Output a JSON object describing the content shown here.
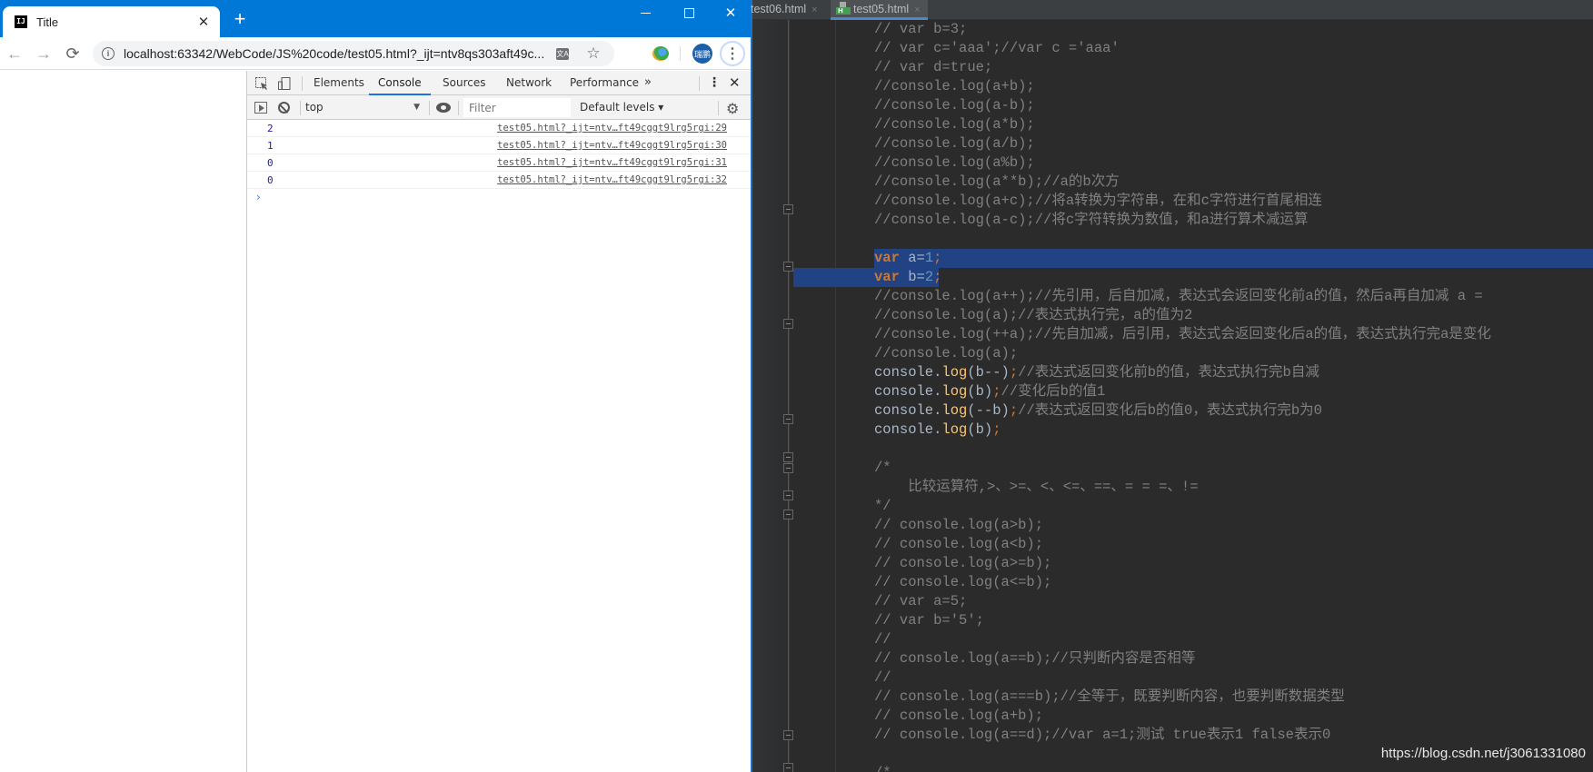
{
  "browser": {
    "tab": {
      "favicon": "IJ",
      "title": "Title",
      "close": "✕"
    },
    "new_tab": "+",
    "window_controls": {
      "minimize": "minimize",
      "maximize": "maximize",
      "close": "✕"
    },
    "nav": {
      "back": "←",
      "forward": "→",
      "reload": "⟳"
    },
    "url": "localhost:63342/WebCode/JS%20code/test05.html?_ijt=ntv8qs303aft49c...",
    "avatar_text": "瑞鹏",
    "menu": "⋮"
  },
  "devtools": {
    "tabs": [
      "Elements",
      "Console",
      "Sources",
      "Network",
      "Performance"
    ],
    "active_tab": "Console",
    "more": "»",
    "kebab": "⋮",
    "close": "✕",
    "context": "top",
    "filter_placeholder": "Filter",
    "levels": "Default levels ▾",
    "console": [
      {
        "value": "2",
        "source": "test05.html?_ijt=ntv…ft49cggt9lrg5rgi:29"
      },
      {
        "value": "1",
        "source": "test05.html?_ijt=ntv…ft49cggt9lrg5rgi:30"
      },
      {
        "value": "0",
        "source": "test05.html?_ijt=ntv…ft49cggt9lrg5rgi:31"
      },
      {
        "value": "0",
        "source": "test05.html?_ijt=ntv…ft49cggt9lrg5rgi:32"
      }
    ],
    "prompt": "›"
  },
  "ide": {
    "tabs": [
      {
        "label": "test06.html",
        "close": "×",
        "active": false
      },
      {
        "label": "test05.html",
        "close": "×",
        "active": true
      }
    ],
    "lines": [
      "// var b=3;",
      "// var c='aaa';//var c ='aaa'",
      "// var d=true;",
      "//console.log(a+b);",
      "//console.log(a-b);",
      "//console.log(a*b);",
      "//console.log(a/b);",
      "//console.log(a%b);",
      "//console.log(a**b);//a的b次方",
      "//console.log(a+c);//将a转换为字符串，在和c字符进行首尾相连",
      "//console.log(a-c);//将c字符转换为数值，和a进行算术减运算",
      "",
      "var a=1;",
      "var b=2;",
      "//console.log(a++);//先引用，后自加减，表达式会返回变化前a的值，然后a再自加减 a = ",
      "//console.log(a);//表达式执行完，a的值为2",
      "//console.log(++a);//先自加减，后引用，表达式会返回变化后a的值，表达式执行完a是变化",
      "//console.log(a);",
      "console.log(b--);//表达式返回变化前b的值，表达式执行完b自减",
      "console.log(b);//变化后b的值1",
      "console.log(--b);//表达式返回变化后b的值0，表达式执行完b为0",
      "console.log(b);",
      "",
      "/*",
      "    比较运算符,>、>=、<、<=、==、= = =、!=",
      "*/",
      "// console.log(a>b);",
      "// console.log(a<b);",
      "// console.log(a>=b);",
      "// console.log(a<=b);",
      "// var a=5;",
      "// var b='5';",
      "//",
      "// console.log(a==b);//只判断内容是否相等",
      "//",
      "// console.log(a===b);//全等于，既要判断内容，也要判断数据类型",
      "// console.log(a+b);",
      "// console.log(a==d);//var a=1;测试 true表示1 false表示0",
      "",
      "/*"
    ],
    "watermark": "https://blog.csdn.net/j3061331080"
  }
}
